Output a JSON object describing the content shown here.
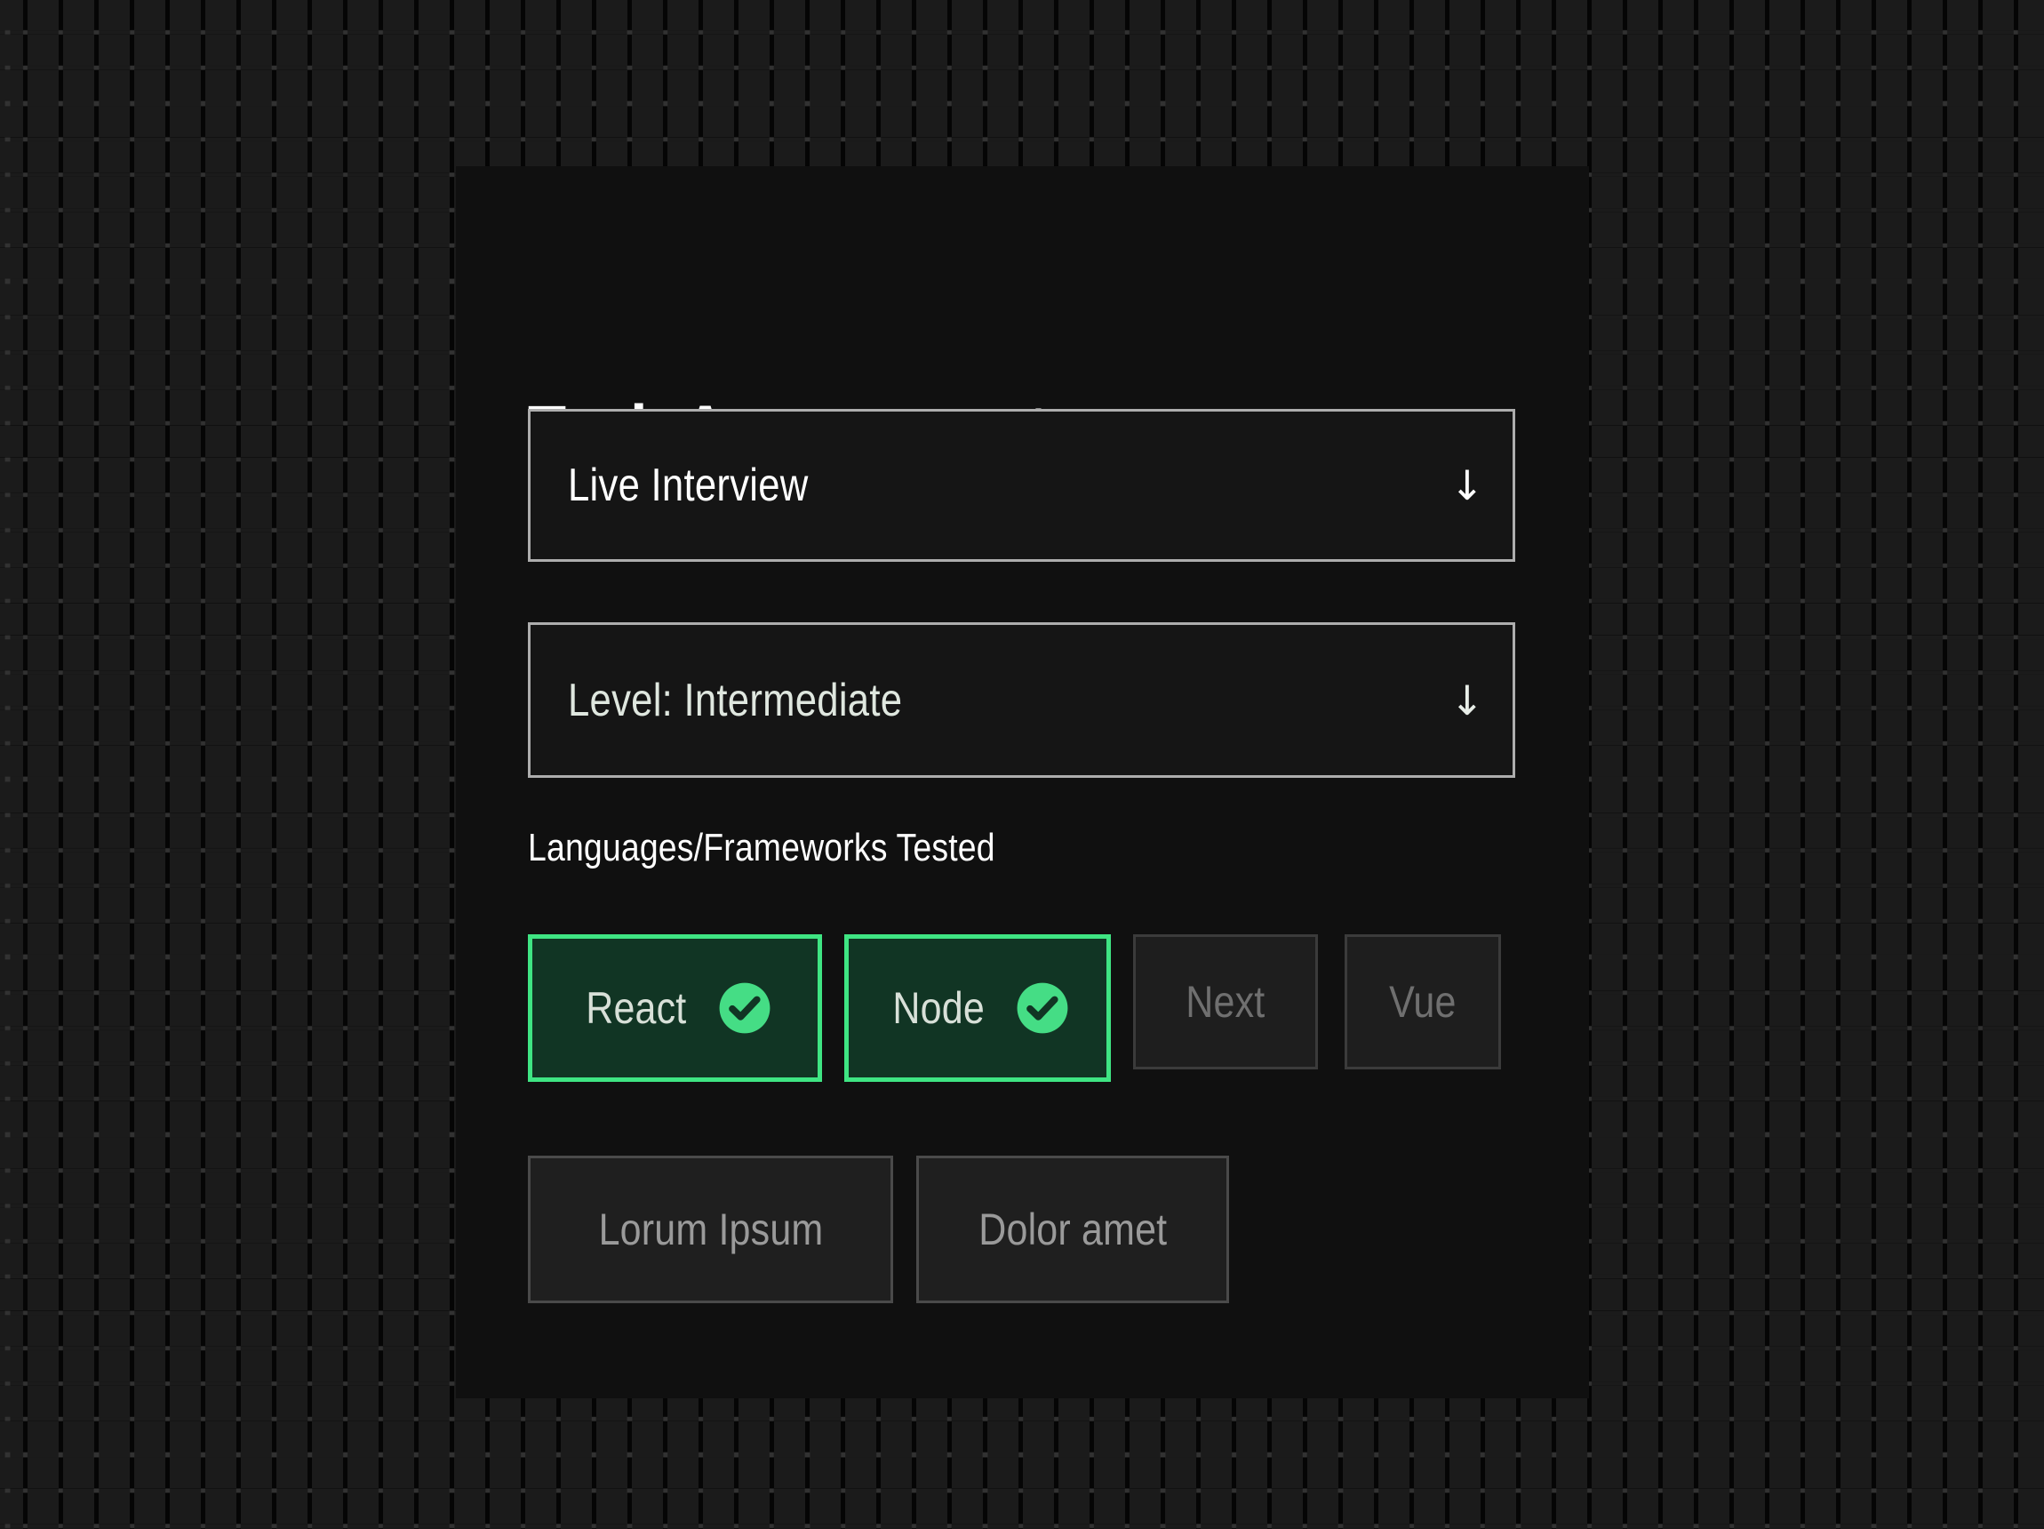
{
  "theme": {
    "page_background": "#1b1b1b",
    "dot_color": "#323232",
    "card_background": "#101010",
    "accent_green": "#3fe583",
    "selected_chip_fill": "#113524",
    "select_border": "#adadad",
    "select_fill": "#151515",
    "unselected_border": "#3b3b3b",
    "unselected_text": "#6f6f6f"
  },
  "card": {
    "title": "Tech Assessment",
    "interview_type_select": {
      "value": "Live Interview",
      "arrow_glyph": "↓",
      "icon": "arrow-down-icon"
    },
    "level_select": {
      "value": "Level: Intermediate",
      "arrow_glyph": "↓",
      "icon": "arrow-down-icon"
    },
    "skills_section": {
      "label": "Languages/Frameworks Tested",
      "rows": [
        {
          "chips": [
            {
              "label": "React",
              "selected": true,
              "icon": "check-circle-icon"
            },
            {
              "label": "Node",
              "selected": true,
              "icon": "check-circle-icon"
            },
            {
              "label": "Next",
              "selected": false
            },
            {
              "label": "Vue",
              "selected": false
            }
          ]
        },
        {
          "chips": [
            {
              "label": "Lorum Ipsum",
              "selected": false
            },
            {
              "label": "Dolor amet",
              "selected": false
            }
          ]
        }
      ]
    }
  }
}
